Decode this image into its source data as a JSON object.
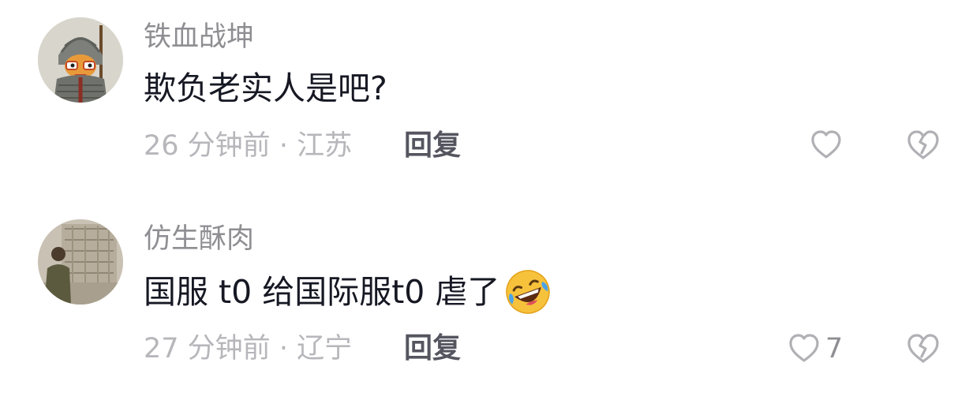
{
  "comments": [
    {
      "username": "铁血战坤",
      "text": "欺负老实人是吧?",
      "emoji": "",
      "time": "26 分钟前",
      "separator": "·",
      "location": "江苏",
      "reply_label": "回复",
      "like_count": "",
      "avatar_icon": "armored-warrior-avatar"
    },
    {
      "username": "仿生酥肉",
      "text": "国服 t0 给国际服t0 虐了",
      "emoji": "🤣",
      "time": "27 分钟前",
      "separator": "·",
      "location": "辽宁",
      "reply_label": "回复",
      "like_count": "7",
      "avatar_icon": "man-in-room-avatar"
    }
  ],
  "icons": {
    "like": "heart-outline-icon",
    "dislike": "broken-heart-outline-icon",
    "emoji": "rolling-on-floor-laughing-emoji"
  },
  "colors": {
    "username": "#8e8e93",
    "text": "#161823",
    "meta": "#b6b6bb",
    "reply": "#555560",
    "icon_stroke": "#b0b0b5"
  }
}
